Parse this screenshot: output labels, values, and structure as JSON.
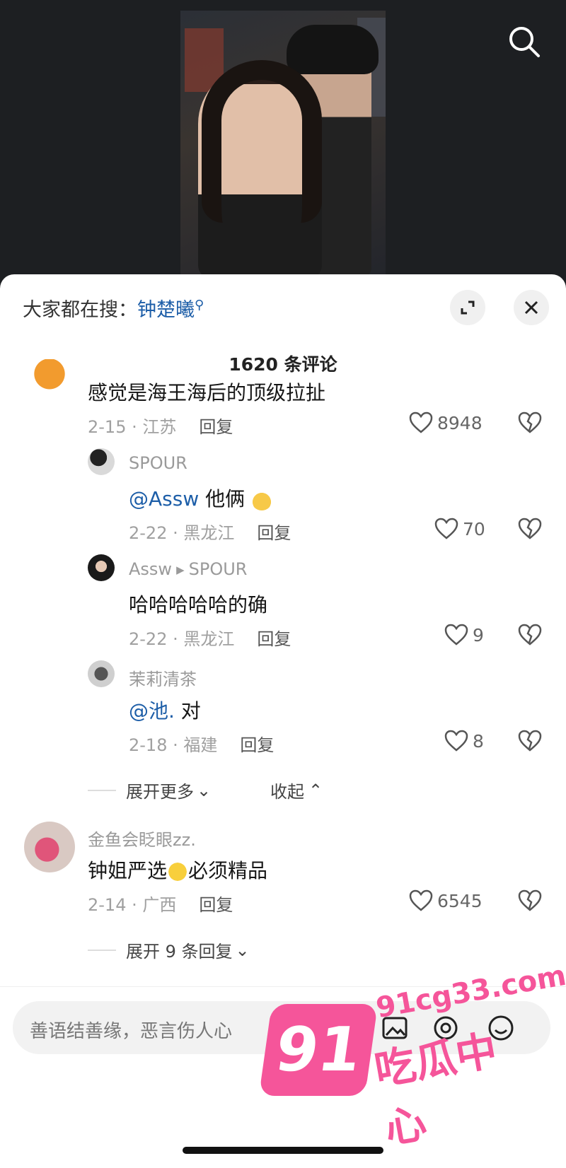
{
  "header": {
    "hot_search_prefix": "大家都在搜：",
    "hot_search_keyword": "钟楚曦"
  },
  "comments_count": "1620 条评论",
  "comments": [
    {
      "text": "感觉是海王海后的顶级拉扯",
      "date": "2-15 · 江苏",
      "reply": "回复",
      "likes": "8948",
      "replies": [
        {
          "name": "SPOUR",
          "mention": "@Assw",
          "text": " 他俩",
          "emoji": "hand-emoji",
          "date": "2-22 · 黑龙江",
          "reply": "回复",
          "likes": "70"
        },
        {
          "name": "Assw",
          "reply_to": "SPOUR",
          "text": "哈哈哈哈哈的确",
          "date": "2-22 · 黑龙江",
          "reply": "回复",
          "likes": "9"
        },
        {
          "name": "茉莉清茶",
          "mention": "@池.",
          "text": " 对",
          "date": "2-18 · 福建",
          "reply": "回复",
          "likes": "8"
        }
      ],
      "expand_more": "展开更多",
      "collapse": "收起"
    },
    {
      "name": "金鱼会眨眼zz.",
      "text_before": "钟姐严选",
      "emoji": "crying-laughing-emoji",
      "text_after": "必须精品",
      "date": "2-14 · 广西",
      "reply": "回复",
      "likes": "6545",
      "expand": "展开 9 条回复"
    }
  ],
  "input": {
    "placeholder": "善语结善缘，恶言伤人心"
  },
  "watermark": {
    "badge": "91",
    "site": "91cg33.com",
    "cn": "吃瓜中心"
  },
  "colors": {
    "link": "#1d5ea8",
    "watermark": "#f5559a"
  }
}
